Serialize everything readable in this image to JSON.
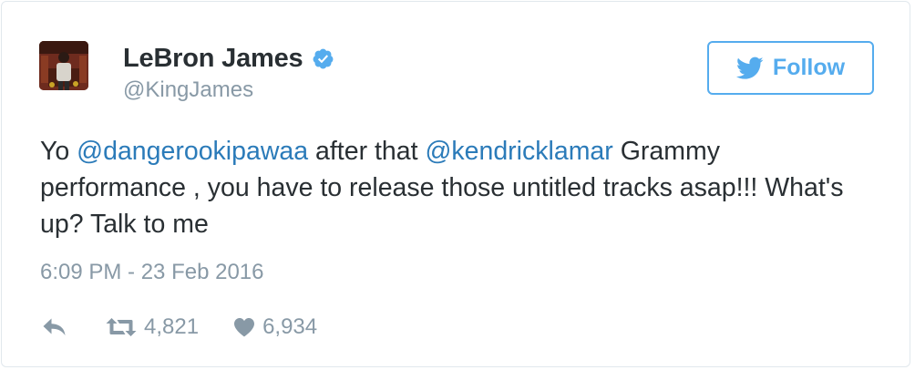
{
  "user": {
    "display_name": "LeBron James",
    "handle": "@KingJames",
    "verified": true
  },
  "follow_button": {
    "label": "Follow"
  },
  "tweet": {
    "segments": [
      {
        "text": "Yo ",
        "type": "text"
      },
      {
        "text": "@dangerookipawaa",
        "type": "mention"
      },
      {
        "text": " after that ",
        "type": "text"
      },
      {
        "text": "@kendricklamar",
        "type": "mention"
      },
      {
        "text": " Grammy performance , you have to release those untitled tracks asap!!! What's up? Talk to me",
        "type": "text"
      }
    ],
    "timestamp": "6:09 PM - 23 Feb 2016"
  },
  "actions": {
    "retweets": "4,821",
    "likes": "6,934"
  },
  "colors": {
    "link": "#2b7bb9",
    "accent": "#55acee",
    "text": "#292f33",
    "muted": "#8899a6",
    "border": "#e1e8ed"
  },
  "icons": {
    "verified": "verified-badge-icon",
    "follow": "twitter-bird-icon",
    "reply": "reply-arrow-icon",
    "retweet": "retweet-icon",
    "like": "heart-icon"
  }
}
